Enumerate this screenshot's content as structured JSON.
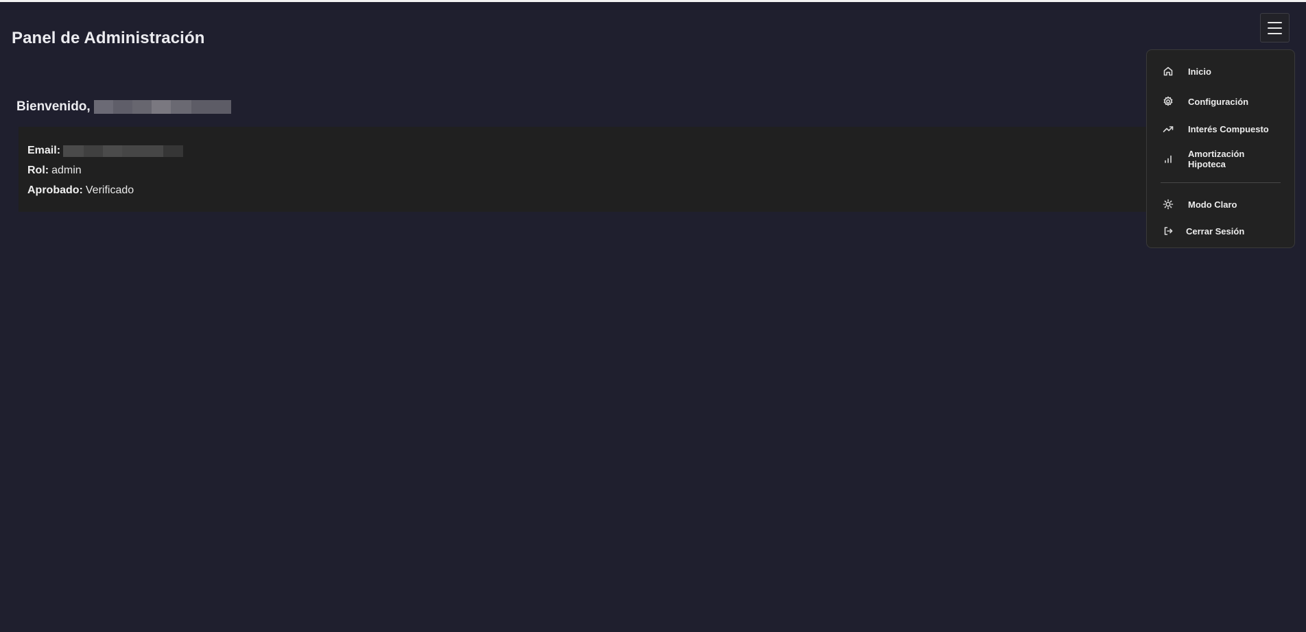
{
  "header": {
    "title": "Panel de Administración",
    "menu_icon": "hamburger-menu-icon"
  },
  "welcome": {
    "label": "Bienvenido,",
    "name_redacted": true
  },
  "profile": {
    "email_label": "Email:",
    "email_redacted": true,
    "rol_label": "Rol:",
    "rol_value": "admin",
    "aprobado_label": "Aprobado:",
    "aprobado_value": "Verificado"
  },
  "menu": {
    "items": [
      {
        "label": "Inicio",
        "icon": "home-icon"
      },
      {
        "label": "Configuración",
        "icon": "gear-icon"
      },
      {
        "label": "Interés Compuesto",
        "icon": "trending-up-icon"
      },
      {
        "label": "Amortización Hipoteca",
        "icon": "bar-chart-icon"
      }
    ],
    "footer_items": [
      {
        "label": "Modo Claro",
        "icon": "sun-icon"
      },
      {
        "label": "Cerrar Sesión",
        "icon": "logout-icon"
      }
    ]
  },
  "colors": {
    "background": "#1f1f2e",
    "card": "#202020",
    "dropdown": "#222222",
    "text": "#ececf0"
  }
}
